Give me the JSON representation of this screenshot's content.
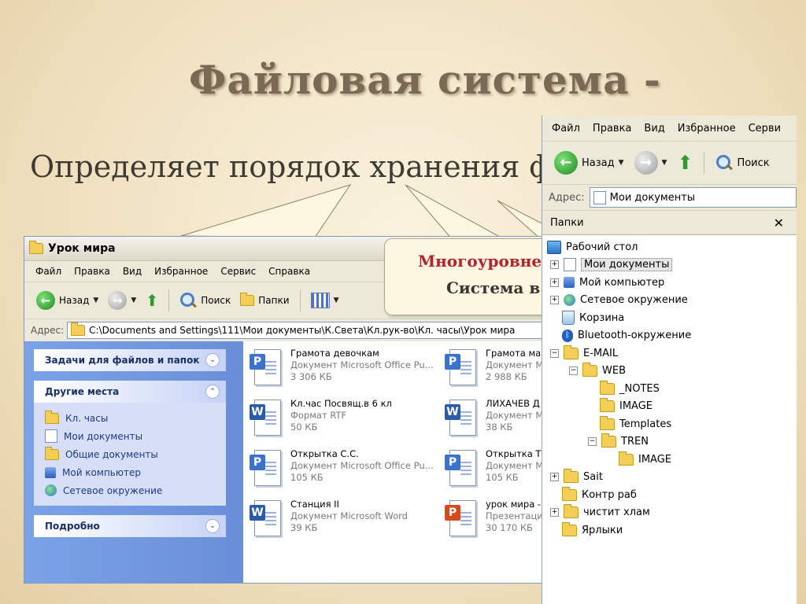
{
  "slide": {
    "title": "Файловая система -",
    "subtitle": "Определяет порядок хранения фай"
  },
  "callout": {
    "line1": "Многоуровне",
    "line2": "Система в"
  },
  "window1": {
    "title": "Урок мира",
    "menu": [
      "Файл",
      "Правка",
      "Вид",
      "Избранное",
      "Сервис",
      "Справка"
    ],
    "toolbar": {
      "back": "Назад",
      "search": "Поиск",
      "folders": "Папки"
    },
    "address": {
      "label": "Адрес:",
      "path": "C:\\Documents and Settings\\111\\Мои документы\\К.Света\\Кл.рук-во\\Кл. часы\\Урок мира"
    },
    "tasks": {
      "file_tasks": "Задачи для файлов и папок",
      "other_places": "Другие места",
      "places": [
        "Кл. часы",
        "Мои документы",
        "Общие документы",
        "Мой компьютер",
        "Сетевое окружение"
      ],
      "details": "Подробно"
    },
    "files": [
      {
        "name": "Грамота девочкам",
        "type": "Документ Microsoft Office Pu...",
        "size": "3 306 КБ",
        "icon": "publisher-icon"
      },
      {
        "name": "Грамота ма",
        "type": "Документ M",
        "size": "2 988 КБ",
        "icon": "publisher-icon"
      },
      {
        "name": "Кл.час Посвящ.в 6 кл",
        "type": "Формат RTF",
        "size": "50 КБ",
        "icon": "word-icon"
      },
      {
        "name": "ЛИХАЧЕВ Д",
        "type": "Документ M",
        "size": "38 КБ",
        "icon": "word-icon"
      },
      {
        "name": "Открытка С.С.",
        "type": "Документ Microsoft Office Pu...",
        "size": "105 КБ",
        "icon": "publisher-icon"
      },
      {
        "name": "Открытка Т",
        "type": "Документ M",
        "size": "105 КБ",
        "icon": "publisher-icon"
      },
      {
        "name": "Станция II",
        "type": "Документ Microsoft Word",
        "size": "39 КБ",
        "icon": "word-icon"
      },
      {
        "name": "урок мира -",
        "type": "Презентаци",
        "size": "30 170 КБ",
        "icon": "powerpoint-icon"
      }
    ]
  },
  "window2": {
    "menu": [
      "Файл",
      "Правка",
      "Вид",
      "Избранное",
      "Серви"
    ],
    "toolbar": {
      "back": "Назад",
      "search": "Поиск"
    },
    "address": {
      "label": "Адрес:",
      "path": "Мои документы"
    },
    "pane_title": "Папки",
    "tree": [
      {
        "label": "Рабочий стол",
        "depth": 0,
        "toggle": "",
        "icon": "desktop-icon"
      },
      {
        "label": "Мои документы",
        "depth": 1,
        "toggle": "+",
        "icon": "my-documents-icon",
        "selected": true
      },
      {
        "label": "Мой компьютер",
        "depth": 1,
        "toggle": "+",
        "icon": "computer-icon"
      },
      {
        "label": "Сетевое окружение",
        "depth": 1,
        "toggle": "+",
        "icon": "network-icon"
      },
      {
        "label": "Корзина",
        "depth": 1,
        "toggle": "",
        "icon": "recycle-bin-icon"
      },
      {
        "label": "Bluetooth-окружение",
        "depth": 1,
        "toggle": "",
        "icon": "bluetooth-icon"
      },
      {
        "label": "E-MAIL",
        "depth": 1,
        "toggle": "−",
        "icon": "folder-icon"
      },
      {
        "label": "WEB",
        "depth": 2,
        "toggle": "−",
        "icon": "folder-icon"
      },
      {
        "label": "_NOTES",
        "depth": 3,
        "toggle": "",
        "icon": "folder-icon"
      },
      {
        "label": "IMAGE",
        "depth": 3,
        "toggle": "",
        "icon": "folder-icon"
      },
      {
        "label": "Templates",
        "depth": 3,
        "toggle": "",
        "icon": "folder-icon"
      },
      {
        "label": "TREN",
        "depth": 3,
        "toggle": "−",
        "icon": "folder-icon"
      },
      {
        "label": "IMAGE",
        "depth": 4,
        "toggle": "",
        "icon": "folder-icon"
      },
      {
        "label": "Sait",
        "depth": 1,
        "toggle": "+",
        "icon": "folder-icon"
      },
      {
        "label": "Контр раб",
        "depth": 1,
        "toggle": "",
        "icon": "folder-icon"
      },
      {
        "label": "чистит хлам",
        "depth": 1,
        "toggle": "+",
        "icon": "folder-icon"
      },
      {
        "label": "Ярлыки",
        "depth": 1,
        "toggle": "",
        "icon": "folder-icon"
      }
    ]
  }
}
